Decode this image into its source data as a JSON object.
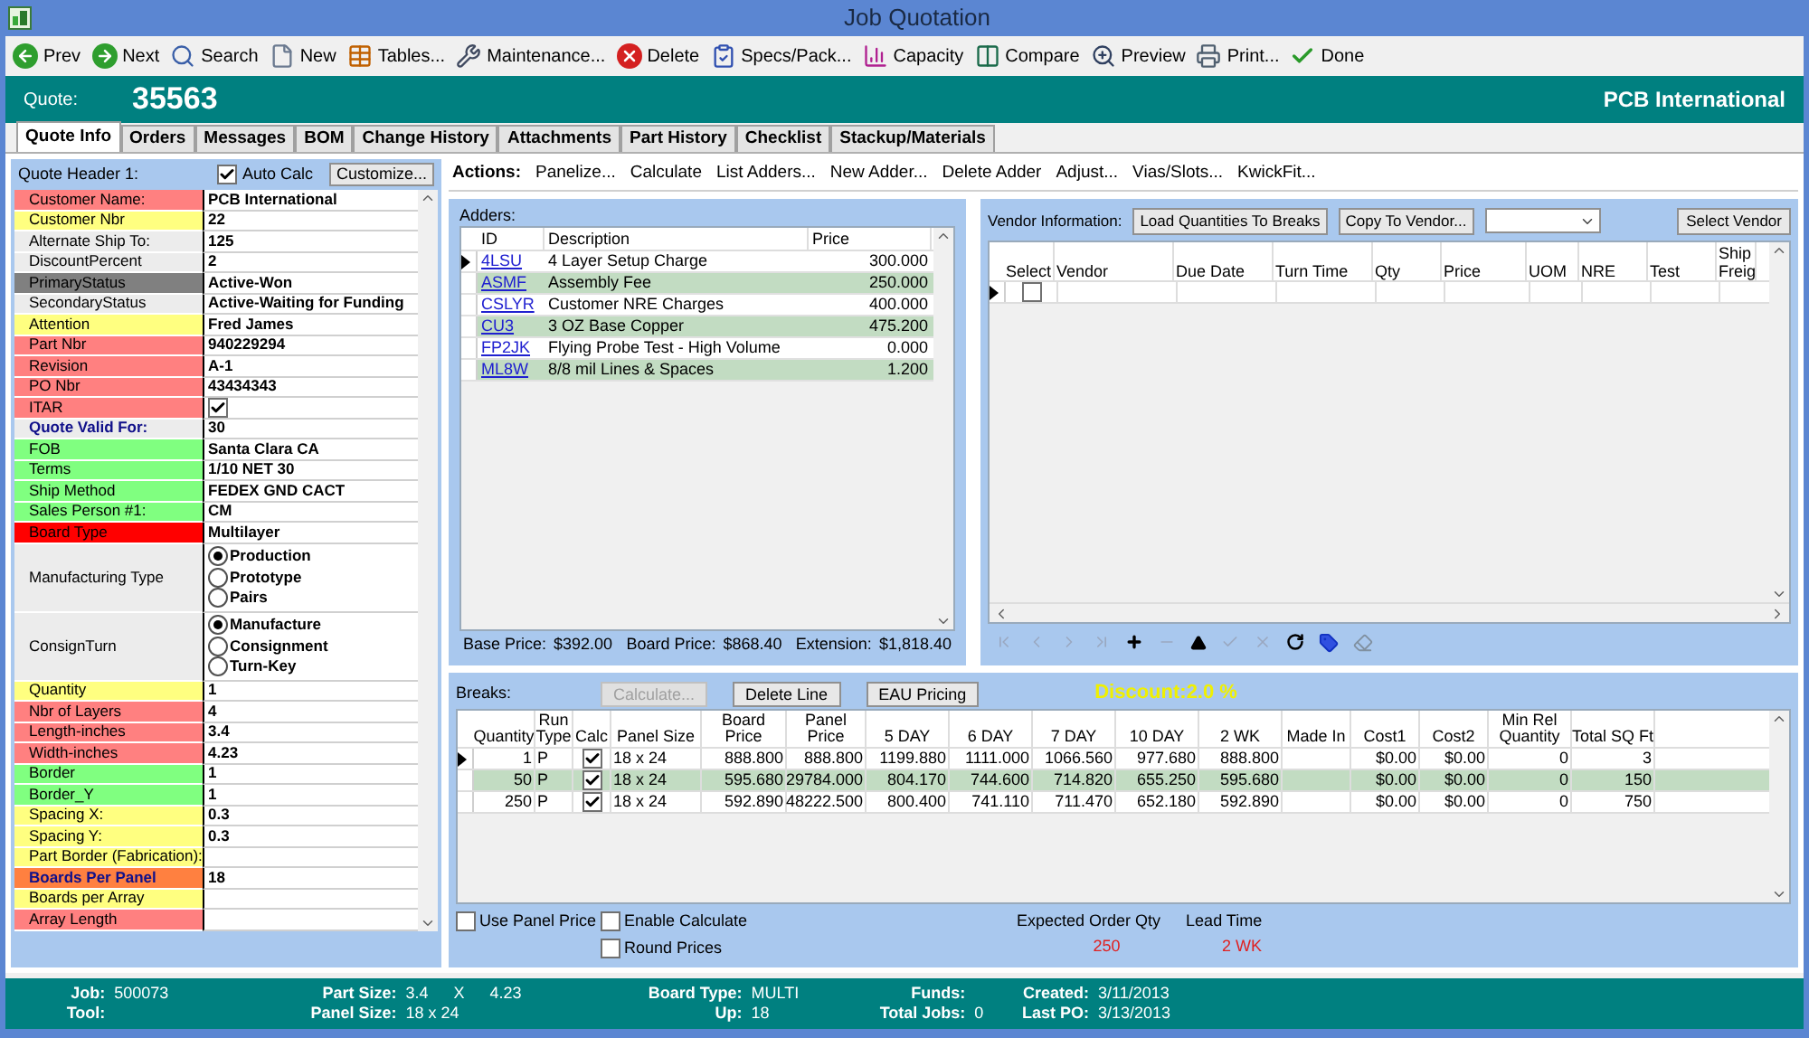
{
  "window": {
    "title": "Job Quotation"
  },
  "toolbar": [
    {
      "label": "Prev"
    },
    {
      "label": "Next"
    },
    {
      "label": "Search"
    },
    {
      "label": "New"
    },
    {
      "label": "Tables..."
    },
    {
      "label": "Maintenance..."
    },
    {
      "label": "Delete"
    },
    {
      "label": "Specs/Pack..."
    },
    {
      "label": "Capacity"
    },
    {
      "label": "Compare"
    },
    {
      "label": "Preview"
    },
    {
      "label": "Print..."
    },
    {
      "label": "Done"
    }
  ],
  "header": {
    "label": "Quote:",
    "number": "35563",
    "customer": "PCB International"
  },
  "tabs": [
    {
      "label": "Quote Info",
      "selected": true
    },
    {
      "label": "Orders",
      "selected": false
    },
    {
      "label": "Messages",
      "selected": false
    },
    {
      "label": "BOM",
      "selected": false
    },
    {
      "label": "Change History",
      "selected": false
    },
    {
      "label": "Attachments",
      "selected": false
    },
    {
      "label": "Part History",
      "selected": false
    },
    {
      "label": "Checklist",
      "selected": false
    },
    {
      "label": "Stackup/Materials",
      "selected": false
    }
  ],
  "quote_header": {
    "title": "Quote Header 1:",
    "auto_calc": {
      "label": "Auto Calc",
      "checked": true
    },
    "customize": "Customize...",
    "fields": [
      {
        "kind": "text",
        "label": "Customer Name:",
        "color": "#ff8080",
        "value": "PCB International"
      },
      {
        "kind": "text",
        "label": "Customer Nbr",
        "color": "#ffff80",
        "value": "22"
      },
      {
        "kind": "text",
        "label": "Alternate Ship To:",
        "color": "#ececec",
        "value": "125"
      },
      {
        "kind": "text",
        "label": "DiscountPercent",
        "color": "#ececec",
        "value": "2"
      },
      {
        "kind": "text",
        "label": "PrimaryStatus",
        "color": "#808080",
        "value": "Active-Won"
      },
      {
        "kind": "text",
        "label": "SecondaryStatus",
        "color": "#ececec",
        "value": "Active-Waiting for Funding"
      },
      {
        "kind": "text",
        "label": "Attention",
        "color": "#ffff80",
        "value": "Fred James"
      },
      {
        "kind": "text",
        "label": "Part Nbr",
        "color": "#ff8080",
        "value": "940229294"
      },
      {
        "kind": "text",
        "label": "Revision",
        "color": "#ff8080",
        "value": "A-1"
      },
      {
        "kind": "text",
        "label": "PO Nbr",
        "color": "#ff8080",
        "value": "43434343"
      },
      {
        "kind": "check",
        "label": "ITAR",
        "color": "#ff8080",
        "checked": true
      },
      {
        "kind": "text",
        "label": "Quote Valid For:",
        "color": "#ececec",
        "emphasis": true,
        "value": "30"
      },
      {
        "kind": "text",
        "label": "FOB",
        "color": "#80ff80",
        "value": "Santa Clara CA"
      },
      {
        "kind": "text",
        "label": "Terms",
        "color": "#80ff80",
        "value": "1/10 NET 30"
      },
      {
        "kind": "text",
        "label": "Ship Method",
        "color": "#80ff80",
        "value": "FEDEX GND CACT"
      },
      {
        "kind": "text",
        "label": "Sales Person #1:",
        "color": "#80ff80",
        "value": "CM"
      },
      {
        "kind": "text",
        "label": "Board Type",
        "color": "#ff0000",
        "value": "Multilayer"
      },
      {
        "kind": "radio",
        "label": "Manufacturing Type",
        "color": "#ececec",
        "options": [
          {
            "label": "Production",
            "selected": true
          },
          {
            "label": "Prototype",
            "selected": false
          },
          {
            "label": "Pairs",
            "selected": false
          }
        ]
      },
      {
        "kind": "radio",
        "label": "ConsignTurn",
        "color": "#ececec",
        "options": [
          {
            "label": "Manufacture",
            "selected": true
          },
          {
            "label": "Consignment",
            "selected": false
          },
          {
            "label": "Turn-Key",
            "selected": false
          }
        ]
      },
      {
        "kind": "text",
        "label": "Quantity",
        "color": "#ffff80",
        "value": "1"
      },
      {
        "kind": "text",
        "label": "Nbr of Layers",
        "color": "#ff8080",
        "value": "4"
      },
      {
        "kind": "text",
        "label": "Length-inches",
        "color": "#ff8080",
        "value": "3.4"
      },
      {
        "kind": "text",
        "label": "Width-inches",
        "color": "#ff8080",
        "value": "4.23"
      },
      {
        "kind": "text",
        "label": "Border",
        "color": "#80ff80",
        "value": "1"
      },
      {
        "kind": "text",
        "label": "Border_Y",
        "color": "#80ff80",
        "value": "1"
      },
      {
        "kind": "text",
        "label": "Spacing X:",
        "color": "#ffff80",
        "value": "0.3"
      },
      {
        "kind": "text",
        "label": "Spacing Y:",
        "color": "#ffff80",
        "value": "0.3"
      },
      {
        "kind": "text",
        "label": "Part Border (Fabrication):",
        "color": "#ffff80"
      },
      {
        "kind": "text",
        "label": "Boards Per Panel",
        "color": "#ff8040",
        "emphasis": true,
        "value": "18"
      },
      {
        "kind": "text",
        "label": "Boards per Array",
        "color": "#ffff80"
      },
      {
        "kind": "text",
        "label": "Array Length",
        "color": "#ff8080"
      }
    ]
  },
  "actions": {
    "label": "Actions:",
    "items": [
      "Panelize...",
      "Calculate",
      "List Adders...",
      "New Adder...",
      "Delete Adder",
      "Adjust...",
      "Vias/Slots...",
      "KwickFit..."
    ]
  },
  "adders": {
    "title": "Adders:",
    "columns": [
      "ID",
      "Description",
      "Price"
    ],
    "rows": [
      {
        "id": "4LSU",
        "description": "4 Layer Setup Charge",
        "price": "300.000",
        "selected": true
      },
      {
        "id": "ASMF",
        "description": "Assembly Fee",
        "price": "250.000",
        "selected": false
      },
      {
        "id": "CSLYR",
        "description": "Customer NRE Charges",
        "price": "400.000",
        "selected": false
      },
      {
        "id": "CU3",
        "description": "3 OZ Base Copper",
        "price": "475.200",
        "selected": false
      },
      {
        "id": "FP2JK",
        "description": "Flying Probe Test - High Volume",
        "price": "0.000",
        "selected": false
      },
      {
        "id": "ML8W",
        "description": "8/8 mil Lines & Spaces",
        "price": "1.200",
        "selected": false
      }
    ],
    "totals": [
      {
        "label": "Base Price:",
        "value": "$392.00"
      },
      {
        "label": "Board Price:",
        "value": "$868.40"
      },
      {
        "label": "Extension:",
        "value": "$1,818.40"
      }
    ]
  },
  "vendor": {
    "title": "Vendor Information:",
    "buttons": [
      "Load Quantities To Breaks",
      "Copy To Vendor..."
    ],
    "select_button": "Select Vendor",
    "columns": [
      "Select",
      "Vendor",
      "Due Date",
      "Turn Time",
      "Qty",
      "Price",
      "UOM",
      "NRE",
      "Test",
      "Ship Freig"
    ],
    "rows": [
      {
        "selected": true,
        "checked": false
      }
    ]
  },
  "breaks": {
    "title": "Breaks:",
    "buttons": [
      {
        "label": "Calculate...",
        "disabled": true
      },
      {
        "label": "Delete Line",
        "disabled": false
      },
      {
        "label": "EAU Pricing",
        "disabled": false
      }
    ],
    "discount": "Discount:2.0 %",
    "columns": [
      "Quantity",
      "Run Type",
      "Calc",
      "Panel Size",
      "Board Price",
      "Panel Price",
      "5 DAY",
      "6 DAY",
      "7 DAY",
      "10 DAY",
      "2 WK",
      "Made In",
      "Cost1",
      "Cost2",
      "Min Rel Quantity",
      "Total SQ Ft"
    ],
    "rows": [
      {
        "selected": true,
        "highlighted": false,
        "quantity": "1",
        "run_type": "P",
        "calc": true,
        "panel_size": "18 x 24",
        "board_price": "888.800",
        "panel_price": "888.800",
        "lead_prices": [
          "1199.880",
          "1111.000",
          "1066.560",
          "977.680",
          "888.800"
        ],
        "cost1": "$0.00",
        "cost2": "$0.00",
        "min_rel_quantity": "0",
        "total_sq_ft": "3"
      },
      {
        "selected": false,
        "highlighted": true,
        "quantity": "50",
        "run_type": "P",
        "calc": true,
        "panel_size": "18 x 24",
        "board_price": "595.680",
        "panel_price": "29784.000",
        "lead_prices": [
          "804.170",
          "744.600",
          "714.820",
          "655.250",
          "595.680"
        ],
        "cost1": "$0.00",
        "cost2": "$0.00",
        "min_rel_quantity": "0",
        "total_sq_ft": "150"
      },
      {
        "selected": false,
        "highlighted": false,
        "quantity": "250",
        "run_type": "P",
        "calc": true,
        "panel_size": "18 x 24",
        "board_price": "592.890",
        "panel_price": "48222.500",
        "lead_prices": [
          "800.400",
          "741.110",
          "711.470",
          "652.180",
          "592.890"
        ],
        "cost1": "$0.00",
        "cost2": "$0.00",
        "min_rel_quantity": "0",
        "total_sq_ft": "750"
      }
    ],
    "options": [
      {
        "label": "Use Panel Price",
        "checked": false
      },
      {
        "label": "Enable Calculate",
        "checked": false
      },
      {
        "label": "Round Prices",
        "checked": false
      }
    ],
    "expected_order_qty": {
      "label": "Expected Order Qty",
      "value": "250"
    },
    "lead_time": {
      "label": "Lead Time",
      "value": "2 WK"
    }
  },
  "footer": [
    [
      {
        "label": "Job:",
        "values": [
          "500073"
        ]
      },
      {
        "label": "Tool:"
      }
    ],
    [
      {
        "label": "Part Size:",
        "values": [
          "3.4",
          "X",
          "4.23"
        ]
      },
      {
        "label": "Panel Size:",
        "values": [
          "18 x 24"
        ]
      }
    ],
    [
      {
        "label": "Board Type:",
        "values": [
          "MULTI"
        ]
      },
      {
        "label": "Up:",
        "values": [
          "18"
        ]
      }
    ],
    [
      {
        "label": "Funds:"
      },
      {
        "label": "Total Jobs:",
        "values": [
          "0"
        ]
      }
    ],
    [
      {
        "label": "Created:",
        "values": [
          "3/11/2013"
        ]
      },
      {
        "label": "Last PO:",
        "values": [
          "3/13/2013"
        ]
      }
    ]
  ]
}
